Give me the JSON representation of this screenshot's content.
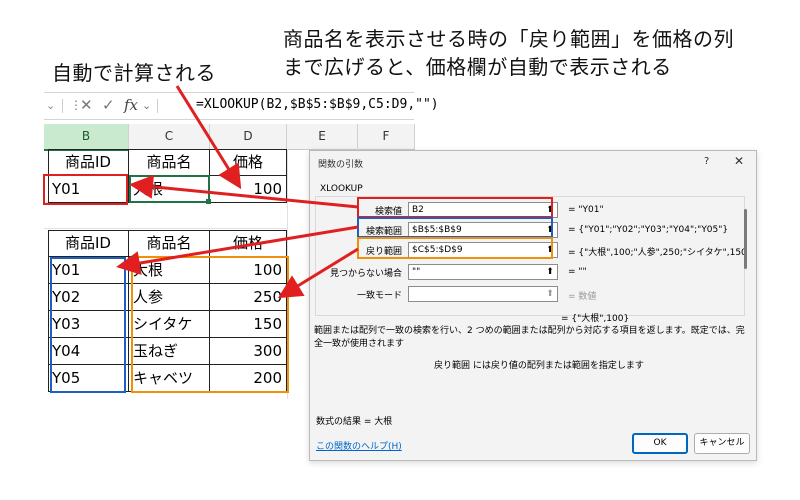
{
  "annotations": {
    "auto": "自動で計算される",
    "top": "商品名を表示させる時の「戻り範囲」を価格の列",
    "bottom": "まで広げると、価格欄が自動で表示される"
  },
  "formula_bar": {
    "cancel_icon": "✕",
    "enter_icon": "✓",
    "fx_label": "fx",
    "formula": "=XLOOKUP(B2,$B$5:$B$9,C5:D9,\"\")"
  },
  "columns": [
    "B",
    "C",
    "D",
    "E",
    "F"
  ],
  "table_top": {
    "headers": [
      "商品ID",
      "商品名",
      "価格"
    ],
    "row": [
      "Y01",
      "大根",
      "100"
    ]
  },
  "table_bottom": {
    "headers": [
      "商品ID",
      "商品名",
      "価格"
    ],
    "rows": [
      [
        "Y01",
        "大根",
        "100"
      ],
      [
        "Y02",
        "人参",
        "250"
      ],
      [
        "Y03",
        "シイタケ",
        "150"
      ],
      [
        "Y04",
        "玉ねぎ",
        "300"
      ],
      [
        "Y05",
        "キャベツ",
        "200"
      ]
    ]
  },
  "dialog": {
    "title": "関数の引数",
    "help_glyph": "?",
    "close_glyph": "✕",
    "function_name": "XLOOKUP",
    "args": [
      {
        "label": "検索値",
        "value": "B2",
        "result": "=  \"Y01\""
      },
      {
        "label": "検索範囲",
        "value": "$B$5:$B$9",
        "result": "=  {\"Y01\";\"Y02\";\"Y03\";\"Y04\";\"Y05\"}"
      },
      {
        "label": "戻り範囲",
        "value": "$C$5:$D$9",
        "result": "=  {\"大根\",100;\"人参\",250;\"シイタケ\",150"
      },
      {
        "label": "見つからない場合",
        "value": "\"\"",
        "result": "=  \"\""
      },
      {
        "label": "一致モード",
        "value": "",
        "result": "=  数値"
      }
    ],
    "total": "=  {\"大根\",100}",
    "description": "範囲または配列で一致の検索を行い、2 つめの範囲または配列から対応する項目を返します。既定では、完全一致が使用されます",
    "sub_description": "戻り範囲  には戻り値の配列または範囲を指定します",
    "result_text": "数式の結果 =   大根",
    "help_link": "この関数のヘルプ(H)",
    "ok_label": "OK",
    "cancel_label": "キャンセル"
  },
  "colors": {
    "red": "#e02020",
    "blue": "#1f5fbf",
    "orange": "#f0900a",
    "green": "#217346"
  }
}
